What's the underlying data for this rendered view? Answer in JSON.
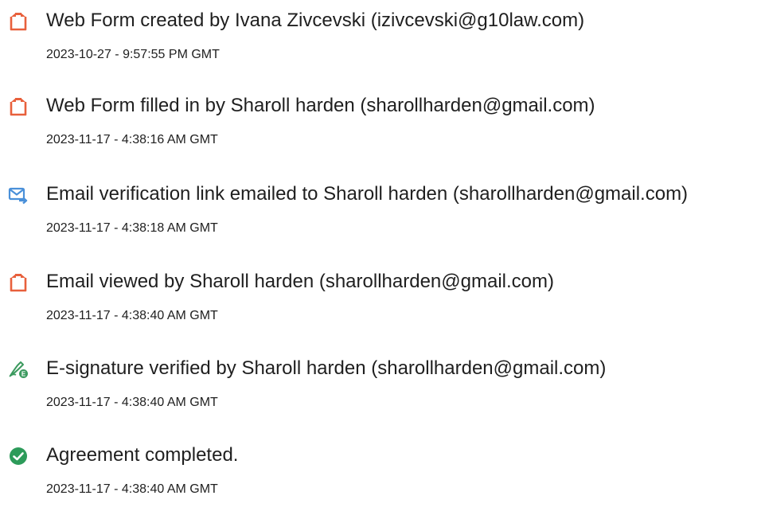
{
  "events": [
    {
      "icon": "web-form-icon",
      "text": "Web Form created by Ivana Zivcevski (izivcevski@g10law.com)",
      "timestamp": "2023-10-27 - 9:57:55 PM GMT"
    },
    {
      "icon": "web-form-icon",
      "text": "Web Form filled in by Sharoll harden (sharollharden@gmail.com)",
      "timestamp": "2023-11-17 - 4:38:16 AM GMT"
    },
    {
      "icon": "email-forward-icon",
      "text": "Email verification link emailed to Sharoll harden (sharollharden@gmail.com)",
      "timestamp": "2023-11-17 - 4:38:18 AM GMT"
    },
    {
      "icon": "web-form-icon",
      "text": "Email viewed by Sharoll harden (sharollharden@gmail.com)",
      "timestamp": "2023-11-17 - 4:38:40 AM GMT"
    },
    {
      "icon": "e-signature-icon",
      "text": "E-signature verified by Sharoll harden (sharollharden@gmail.com)",
      "timestamp": "2023-11-17 - 4:38:40 AM GMT"
    },
    {
      "icon": "check-circle-icon",
      "text": "Agreement completed.",
      "timestamp": "2023-11-17 - 4:38:40 AM GMT"
    }
  ],
  "colors": {
    "form_icon": "#e8603c",
    "email_icon": "#4a90d9",
    "signature_icon": "#3c9a5f",
    "check_icon": "#2d9b5a",
    "text": "#1f1f1f"
  }
}
